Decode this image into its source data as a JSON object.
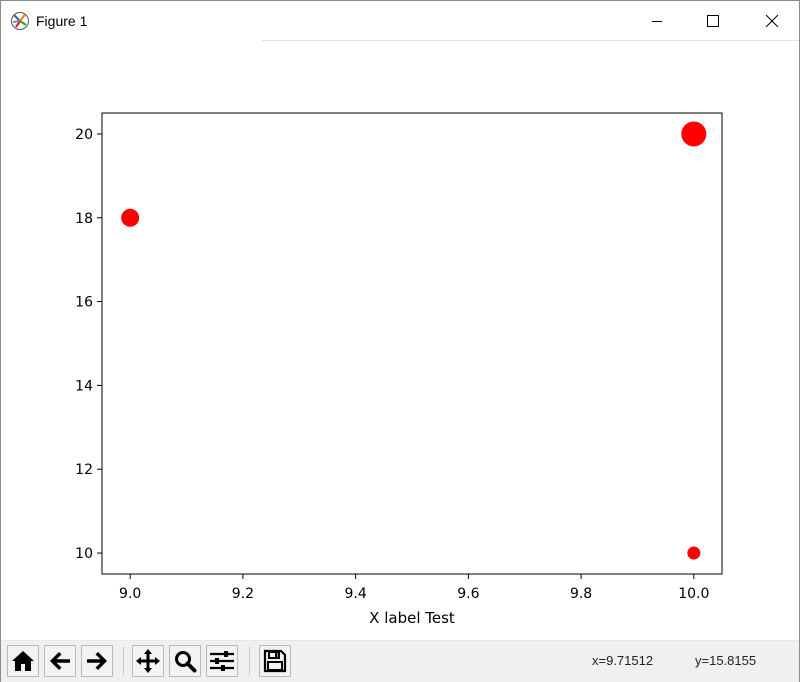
{
  "window": {
    "title": "Figure 1",
    "icons": {
      "app": "matplotlib-logo-icon",
      "minimize": "minimize-icon",
      "maximize": "maximize-icon",
      "close": "close-icon"
    }
  },
  "toolbar": {
    "buttons": [
      {
        "name": "home-button",
        "icon": "home-icon"
      },
      {
        "name": "back-button",
        "icon": "arrow-left-icon"
      },
      {
        "name": "forward-button",
        "icon": "arrow-right-icon"
      },
      {
        "name": "pan-button",
        "icon": "move-icon"
      },
      {
        "name": "zoom-button",
        "icon": "magnifier-icon"
      },
      {
        "name": "configure-subplots-button",
        "icon": "sliders-icon"
      },
      {
        "name": "save-button",
        "icon": "floppy-disk-icon"
      }
    ],
    "coords": {
      "x": "x=9.71512",
      "y": "y=15.8155"
    }
  },
  "chart_data": {
    "type": "scatter",
    "title": "",
    "xlabel": "X label Test",
    "ylabel": "",
    "xlim": [
      8.95,
      10.05
    ],
    "ylim": [
      9.5,
      20.5
    ],
    "xticks": [
      9.0,
      9.2,
      9.4,
      9.6,
      9.8,
      10.0
    ],
    "xtick_labels": [
      "9.0",
      "9.2",
      "9.4",
      "9.6",
      "9.8",
      "10.0"
    ],
    "yticks": [
      10,
      12,
      14,
      16,
      18,
      20
    ],
    "ytick_labels": [
      "10",
      "12",
      "14",
      "16",
      "18",
      "20"
    ],
    "grid": false,
    "color": "#ff0000",
    "points": [
      {
        "x": 9.0,
        "y": 18,
        "size": 18
      },
      {
        "x": 10.0,
        "y": 20,
        "size": 25
      },
      {
        "x": 10.0,
        "y": 10,
        "size": 13
      }
    ]
  }
}
